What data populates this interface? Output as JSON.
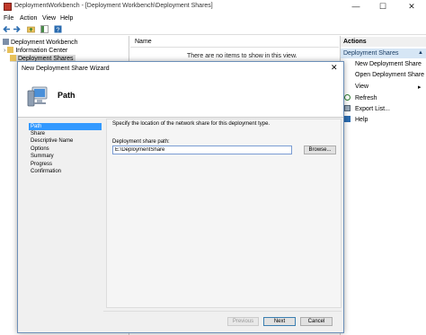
{
  "window": {
    "title": "DeploymentWorkbench - [Deployment Workbench\\Deployment Shares]",
    "minimize": "—",
    "maximize": "☐",
    "close": "✕"
  },
  "menu": [
    "File",
    "Action",
    "View",
    "Help"
  ],
  "tree": {
    "root": "Deployment Workbench",
    "info_center": "Information Center",
    "deployment_shares": "Deployment Shares",
    "expand_glyph": "›"
  },
  "list": {
    "column_name": "Name",
    "empty_message": "There are no items to show in this view."
  },
  "actions": {
    "header": "Actions",
    "section": "Deployment Shares",
    "section_arrow": "▲",
    "items": [
      {
        "label": "New Deployment Share",
        "arrow": ""
      },
      {
        "label": "Open Deployment Share",
        "arrow": ""
      },
      {
        "label": "View",
        "arrow": "▸"
      },
      {
        "label": "Refresh",
        "arrow": ""
      },
      {
        "label": "Export List...",
        "arrow": ""
      },
      {
        "label": "Help",
        "arrow": ""
      }
    ]
  },
  "dialog": {
    "title": "New Deployment Share Wizard",
    "close": "✕",
    "header_title": "Path",
    "steps": [
      "Path",
      "Share",
      "Descriptive Name",
      "Options",
      "Summary",
      "Progress",
      "Confirmation"
    ],
    "selected_step": 0,
    "instruction": "Specify the location of the network share for this deployment type.",
    "path_label": "Deployment share path:",
    "path_value": "E:\\DeploymentShare",
    "browse": "Browse...",
    "previous": "Previous",
    "next": "Next",
    "cancel": "Cancel"
  },
  "colors": {
    "selection": "#3399ff",
    "actions_section_bg": "#d6e6f5",
    "dialog_border": "#6c8fb8"
  }
}
